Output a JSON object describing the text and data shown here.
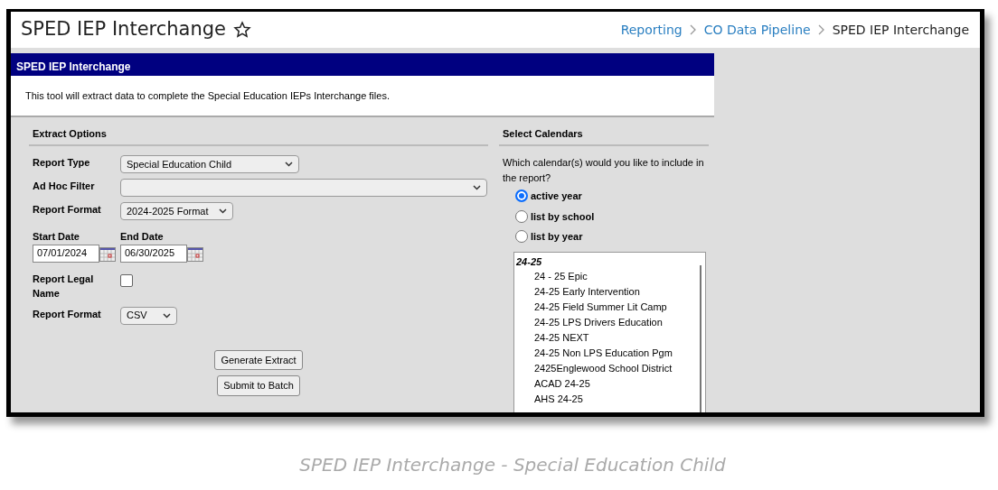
{
  "header": {
    "title": "SPED IEP Interchange",
    "favorite": false,
    "breadcrumbs": [
      {
        "label": "Reporting",
        "link": true
      },
      {
        "label": "CO Data Pipeline",
        "link": true
      },
      {
        "label": "SPED IEP Interchange",
        "link": false
      }
    ]
  },
  "panel": {
    "title": "SPED IEP Interchange",
    "description": "This tool will extract data to complete the Special Education IEPs Interchange files."
  },
  "extract_options": {
    "heading": "Extract Options",
    "fields": [
      {
        "kind": "select",
        "label": "Report Type",
        "value": "Special Education Child"
      },
      {
        "kind": "select",
        "label": "Ad Hoc Filter"
      },
      {
        "kind": "select",
        "label": "Report Format",
        "value": "2024-2025 Format"
      },
      {
        "kind": "dates",
        "start_label": "Start Date",
        "start_value": "07/01/2024",
        "end_label": "End Date",
        "end_value": "06/30/2025"
      },
      {
        "kind": "checkbox",
        "label": "Report Legal Name",
        "checked": false
      },
      {
        "kind": "select",
        "label": "Report Format",
        "value": "CSV"
      }
    ],
    "buttons": [
      "Generate Extract",
      "Submit to Batch"
    ]
  },
  "select_calendars": {
    "heading": "Select Calendars",
    "question": "Which calendar(s) would you like to include in the report?",
    "options": [
      {
        "label": "active year",
        "selected": true
      },
      {
        "label": "list by school",
        "selected": false
      },
      {
        "label": "list by year",
        "selected": false
      }
    ],
    "calendar_list": [
      {
        "label": "24-25",
        "children": [
          {
            "label": "24 - 25 Epic"
          },
          {
            "label": "24-25 Early Intervention"
          },
          {
            "label": "24-25 Field Summer Lit Camp"
          },
          {
            "label": "24-25 LPS Drivers Education"
          },
          {
            "label": "24-25 NEXT"
          },
          {
            "label": "24-25 Non LPS Education Pgm"
          },
          {
            "label": "2425Englewood School District"
          },
          {
            "label": "ACAD 24-25"
          },
          {
            "label": "AHS 24-25"
          }
        ]
      }
    ]
  },
  "caption": "SPED IEP Interchange - Special Education Child"
}
